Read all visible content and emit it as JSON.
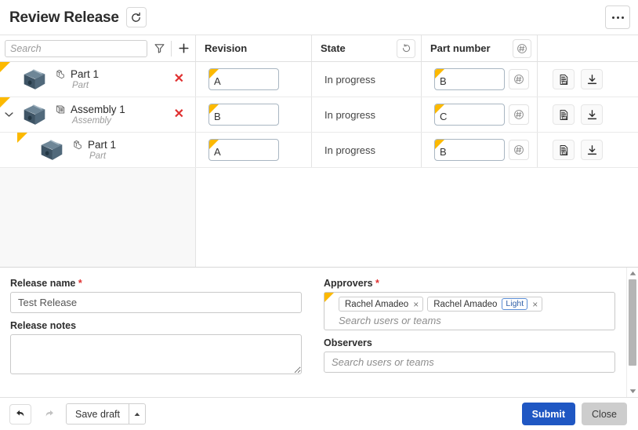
{
  "header": {
    "title": "Review Release",
    "refresh_icon": "refresh-icon",
    "more_icon": "more-options-icon"
  },
  "table": {
    "search": {
      "placeholder": "Search",
      "value": ""
    },
    "filter_icon": "filter-icon",
    "add_icon": "plus-icon",
    "columns": [
      {
        "label": "Revision",
        "badge_icon": ""
      },
      {
        "label": "State",
        "badge_icon": "rotate-state-icon"
      },
      {
        "label": "Part number",
        "badge_icon": "hash-generate-icon"
      }
    ],
    "rows": [
      {
        "name": "Part 1",
        "type": "Part",
        "type_icon": "part-icon",
        "thumbnail_icon": "part-thumbnail",
        "indent": 0,
        "expandable": false,
        "expanded": false,
        "deletable": true,
        "delete_icon": "delete-x-icon",
        "revision": "A",
        "state": "In progress",
        "part_number": "B",
        "pn_badge_icon": "hash-generate-icon",
        "actions": [
          "properties-icon",
          "download-icon"
        ]
      },
      {
        "name": "Assembly 1",
        "type": "Assembly",
        "type_icon": "assembly-icon",
        "thumbnail_icon": "part-thumbnail",
        "indent": 0,
        "expandable": true,
        "expanded": true,
        "deletable": true,
        "delete_icon": "delete-x-icon",
        "revision": "B",
        "state": "In progress",
        "part_number": "C",
        "pn_badge_icon": "hash-generate-icon",
        "actions": [
          "properties-icon",
          "download-icon"
        ]
      },
      {
        "name": "Part 1",
        "type": "Part",
        "type_icon": "part-icon",
        "thumbnail_icon": "part-thumbnail",
        "indent": 1,
        "expandable": false,
        "expanded": false,
        "deletable": false,
        "delete_icon": "",
        "revision": "A",
        "state": "In progress",
        "part_number": "B",
        "pn_badge_icon": "hash-generate-icon",
        "actions": [
          "properties-icon",
          "download-icon"
        ]
      }
    ]
  },
  "form": {
    "release_name": {
      "label": "Release name",
      "required": true,
      "value": "Test Release"
    },
    "release_notes": {
      "label": "Release notes",
      "required": false,
      "value": ""
    },
    "approvers": {
      "label": "Approvers",
      "required": true,
      "placeholder": "Search users or teams",
      "chips": [
        {
          "name": "Rachel Amadeo",
          "badge": "",
          "remove_icon": "chip-remove-icon"
        },
        {
          "name": "Rachel Amadeo",
          "badge": "Light",
          "remove_icon": "chip-remove-icon"
        }
      ]
    },
    "observers": {
      "label": "Observers",
      "required": false,
      "placeholder": "Search users or teams",
      "chips": []
    }
  },
  "footer": {
    "undo_icon": "undo-icon",
    "redo_icon": "redo-icon",
    "save_draft_label": "Save draft",
    "save_draft_caret_icon": "caret-up-icon",
    "submit_label": "Submit",
    "close_label": "Close"
  },
  "colors": {
    "accent_yellow": "#fcb900",
    "primary_blue": "#1f57c3",
    "delete_red": "#e03131",
    "thumbnail_slate": "#4a6071"
  }
}
